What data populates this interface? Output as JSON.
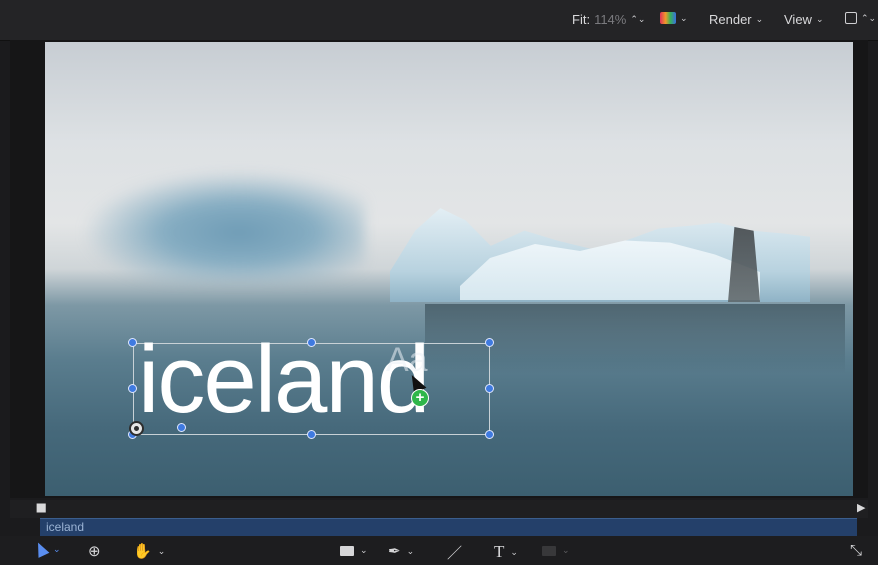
{
  "topbar": {
    "fit_label": "Fit:",
    "fit_value": "114%",
    "fit_chevron": "⌃⌄",
    "render_label": "Render",
    "view_label": "View",
    "chevron": "⌄",
    "layout_chevron": "⌃⌄"
  },
  "canvas": {
    "title_text": "iceland",
    "aa_hint": "Aa",
    "plus_badge": "+"
  },
  "timeline": {
    "track_label": "iceland",
    "start_marker": "⯀",
    "end_marker": "▶"
  },
  "toolbar": {
    "chevron": "⌄",
    "transform_icon": "⊕",
    "hand_icon": "✋",
    "pen_icon": "✒",
    "brush_icon": "／",
    "text_icon": "T",
    "fullscreen_icon": "⤡"
  },
  "colors": {
    "accent": "#3f7ae0",
    "track": "#24406a",
    "add_badge": "#2fb64a"
  }
}
